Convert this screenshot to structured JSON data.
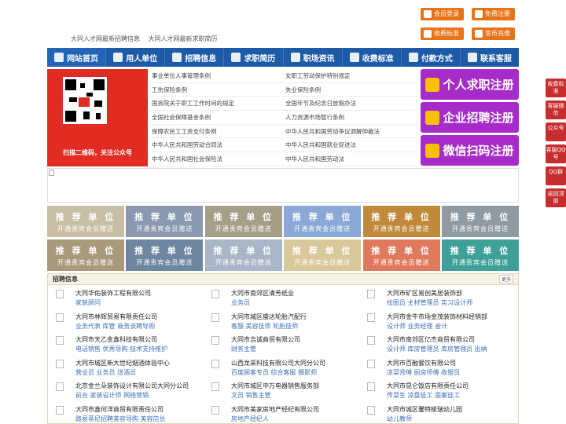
{
  "top_links": [
    "大同人才网最新招聘信息",
    "大同人才网最新求职简历"
  ],
  "top_buttons": [
    "会员登录",
    "免费注册",
    "收费标准",
    "金币充值"
  ],
  "nav": [
    "网站首页",
    "用人单位",
    "招聘信息",
    "求职简历",
    "职场资讯",
    "收费标准",
    "付款方式",
    "联系客服"
  ],
  "qr_caption": "扫描二维码，关注公众号",
  "policy_links": [
    [
      "事业单位人事管理条例",
      "女职工劳动保护特别规定"
    ],
    [
      "工伤保险条例",
      "失业保险条例"
    ],
    [
      "国务院关于职工工作时间的规定",
      "全国年节及纪念日放假办法"
    ],
    [
      "全国社会保障基金条例",
      "人力资源市场暂行条例"
    ],
    [
      "保障农民工工资支付条例",
      "中华人民共和国劳动争议调解仲裁法"
    ],
    [
      "中华人民共和国劳动合同法",
      "中华人民共和国就业促进法"
    ],
    [
      "中华人民共和国社会保险法",
      "中华人民共和国劳动法"
    ]
  ],
  "register": [
    "个人求职注册",
    "企业招聘注册",
    "微信扫码注册"
  ],
  "promo": {
    "title": "推 荐 单 位",
    "sub": "开通贵宾会员赠送",
    "colors": [
      "#c8bfa4",
      "#8a99b0",
      "#a59f88",
      "#8aa9d6",
      "#c08a3a",
      "#8f9aa3",
      "#a99a7c",
      "#6e86a0",
      "#a8b6c8",
      "#d8c89a",
      "#e07a5e",
      "#3fa09a"
    ]
  },
  "jobs_title": "招聘信息",
  "more": "更多",
  "jobs": [
    {
      "co": "大同华佑装饰工程有限公司",
      "pos": "家装顾问"
    },
    {
      "co": "大同市南郊区清芳纸业",
      "pos": "业务员"
    },
    {
      "co": "大同市矿区易创美居装饰部",
      "pos": "绘图员 主材管理员 实习设计师"
    },
    {
      "co": "大同市林辉贸易有限责任公司",
      "pos": "业务代表 库管 商务谈聘导购"
    },
    {
      "co": "大同市城区盛达轮胎汽配行",
      "pos": "客服 美容技师 轮胎技师"
    },
    {
      "co": "大同市金牛市场金茂装饰材料经销部",
      "pos": "设计师 业务经理 会计"
    },
    {
      "co": "大同市天乙金鑫科技有限公司",
      "pos": "电话销售 优秀导购 技术支持维护"
    },
    {
      "co": "大同市吉诚商贸有限公司",
      "pos": "财务主管"
    },
    {
      "co": "大同市南郊区亿杰商贸有限公司",
      "pos": "设计师 库房管理员 库房管理员 出纳"
    },
    {
      "co": "大同市城区新大世纪烟酒体验中心",
      "pos": "营业员 业务员 送酒员"
    },
    {
      "co": "山西龙采科技有限公司大同分公司",
      "pos": "百度顾客专员 综合客服 摄影师"
    },
    {
      "co": "大同市百融餐饮有限公司",
      "pos": "凉菜师傅 厨房师傅 收银员"
    },
    {
      "co": "北京金兰朵装饰设计有限公司大同分公司",
      "pos": "前台 家装设计师 网络营销"
    },
    {
      "co": "大同市城区中万电器销售服务部",
      "pos": "文员 销售主管"
    },
    {
      "co": "大同市昆仑饭店有限责任公司",
      "pos": "传菜生 凉盘徒工 面案徒工"
    },
    {
      "co": "大同市鑫何洋商贸有限责任公司",
      "pos": "路易蒂尼招聘美容导购 美容店长"
    },
    {
      "co": "大同市美家房地产经纪有限公司",
      "pos": "房地产经纪人"
    },
    {
      "co": "大同市城区馨特梭瑞幼儿园",
      "pos": "幼儿教师"
    }
  ],
  "side": [
    "收费标准",
    "客服微信",
    "公众号",
    "客服QQ号",
    "QQ群",
    "返回顶部"
  ]
}
